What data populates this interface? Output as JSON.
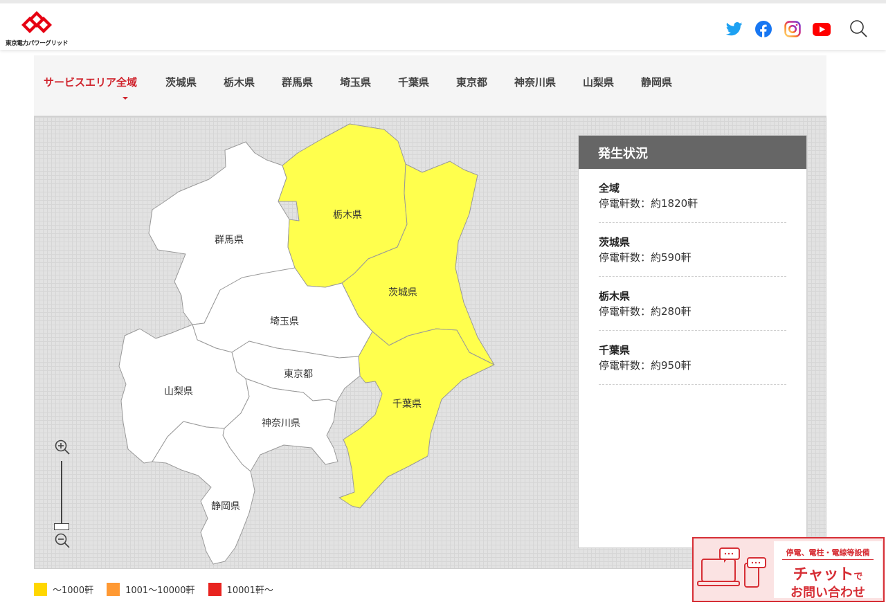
{
  "header": {
    "logo_text": "東京電力パワーグリッド",
    "brand_color": "#e60012",
    "icons": [
      "twitter-icon",
      "facebook-icon",
      "instagram-icon",
      "youtube-icon",
      "search-icon"
    ]
  },
  "tabs": [
    {
      "label": "サービスエリア全域",
      "active": true
    },
    {
      "label": "茨城県"
    },
    {
      "label": "栃木県"
    },
    {
      "label": "群馬県"
    },
    {
      "label": "埼玉県"
    },
    {
      "label": "千葉県"
    },
    {
      "label": "東京都"
    },
    {
      "label": "神奈川県"
    },
    {
      "label": "山梨県"
    },
    {
      "label": "静岡県"
    }
  ],
  "map": {
    "prefectures": [
      {
        "name": "栃木県",
        "level": "〜1000軒",
        "color": "#ffff4d"
      },
      {
        "name": "茨城県",
        "level": "〜1000軒",
        "color": "#ffff4d"
      },
      {
        "name": "千葉県",
        "level": "〜1000軒",
        "color": "#ffff4d"
      },
      {
        "name": "群馬県",
        "level": "none",
        "color": "#ffffff"
      },
      {
        "name": "埼玉県",
        "level": "none",
        "color": "#ffffff"
      },
      {
        "name": "東京都",
        "level": "none",
        "color": "#ffffff"
      },
      {
        "name": "山梨県",
        "level": "none",
        "color": "#ffffff"
      },
      {
        "name": "神奈川県",
        "level": "none",
        "color": "#ffffff"
      },
      {
        "name": "静岡県",
        "level": "none",
        "color": "#ffffff"
      }
    ],
    "zoom_controls": [
      "zoom-in-icon",
      "zoom-out-icon"
    ]
  },
  "status": {
    "title": "発生状況",
    "items": [
      {
        "name": "全域",
        "value": "停電軒数：約1820軒"
      },
      {
        "name": "茨城県",
        "value": "停電軒数：約590軒"
      },
      {
        "name": "栃木県",
        "value": "停電軒数：約280軒"
      },
      {
        "name": "千葉県",
        "value": "停電軒数：約950軒"
      }
    ]
  },
  "legend": [
    {
      "label": "〜1000軒",
      "color": "#ffd700"
    },
    {
      "label": "1001〜10000軒",
      "color": "#ff9933"
    },
    {
      "label": "10001軒〜",
      "color": "#e8231f"
    }
  ],
  "chat_banner": {
    "title": "停電、電柱・電線等設備",
    "main_big": "チャット",
    "main_small": "で",
    "sub": "お問い合わせ"
  }
}
